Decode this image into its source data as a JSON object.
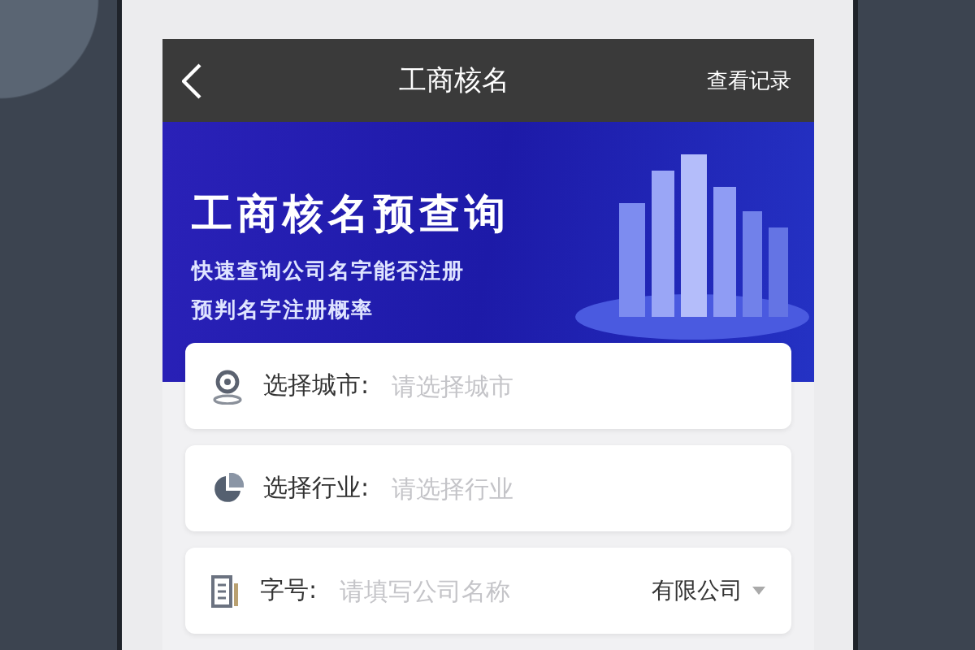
{
  "nav": {
    "title": "工商核名",
    "action": "查看记录"
  },
  "banner": {
    "title": "工商核名预查询",
    "lines": [
      "快速查询公司名字能否注册",
      "预判名字注册概率"
    ]
  },
  "fields": [
    {
      "kind": "city",
      "label": "选择城市:",
      "placeholder": "请选择城市"
    },
    {
      "kind": "industry",
      "label": "选择行业:",
      "placeholder": "请选择行业"
    },
    {
      "kind": "name",
      "label": "字号:",
      "placeholder": "请填写公司名称",
      "suffix": "有限公司"
    }
  ]
}
